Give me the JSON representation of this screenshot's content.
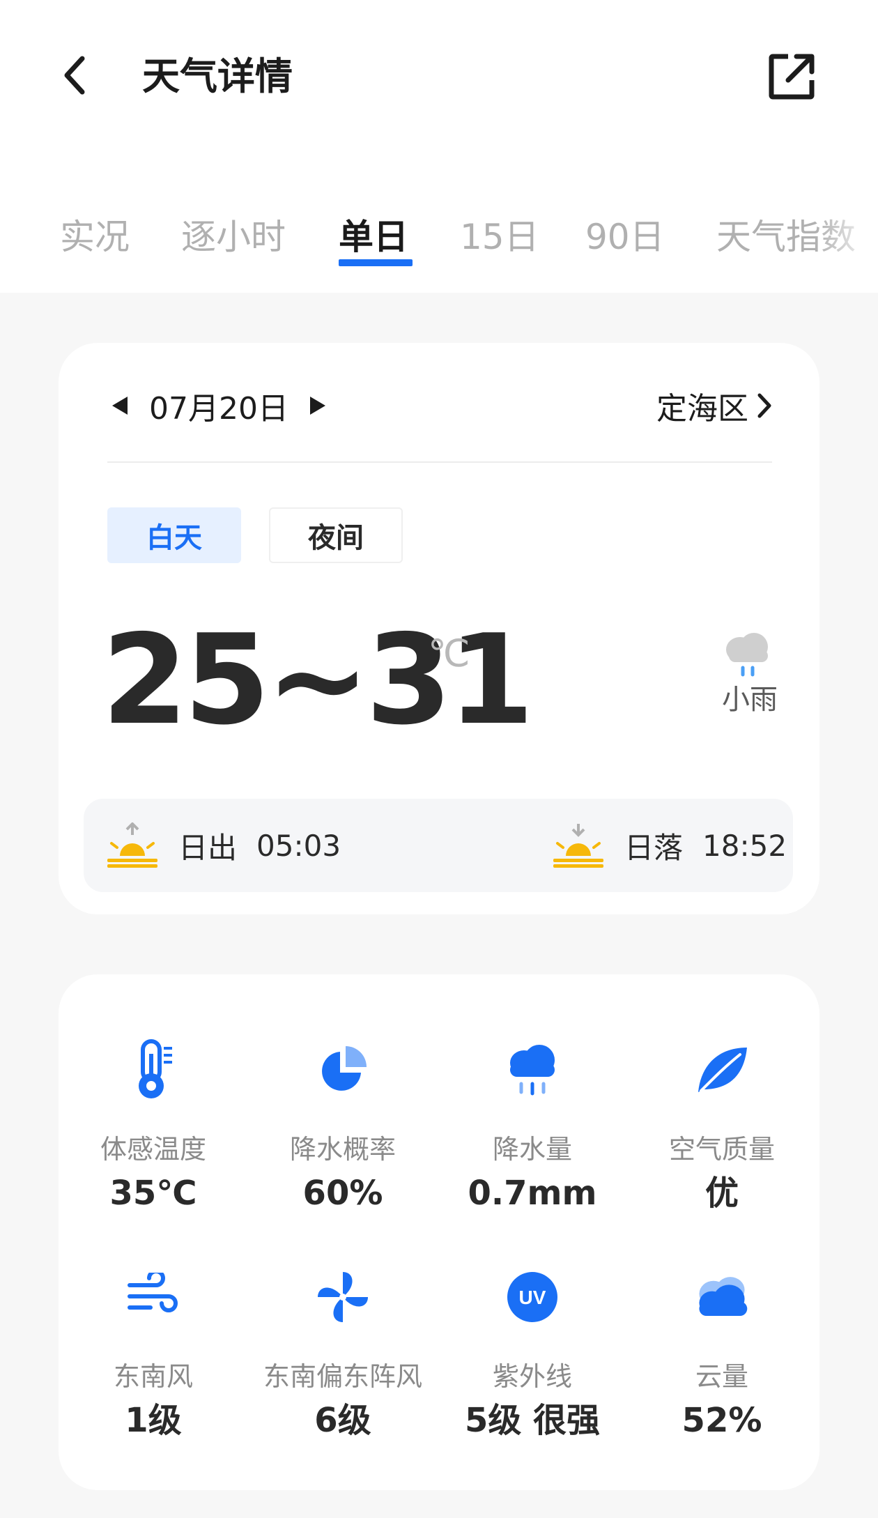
{
  "header": {
    "title": "天气详情",
    "back_icon": "back-arrow-icon",
    "share_icon": "open-external-icon"
  },
  "tabs": [
    {
      "label": "实况",
      "active": false
    },
    {
      "label": "逐小时",
      "active": false
    },
    {
      "label": "单日",
      "active": true
    },
    {
      "label": "15日",
      "active": false
    },
    {
      "label": "90日",
      "active": false
    },
    {
      "label": "天气指数",
      "active": false
    }
  ],
  "day_card": {
    "date": "07月20日",
    "location": "定海区",
    "segments": {
      "day": "白天",
      "night": "夜间",
      "selected": "day"
    },
    "temperature": "25~31",
    "unit": "℃",
    "condition": "小雨",
    "sunrise": {
      "label": "日出",
      "time": "05:03"
    },
    "sunset": {
      "label": "日落",
      "time": "18:52"
    }
  },
  "metrics": [
    {
      "icon": "thermometer-icon",
      "label": "体感温度",
      "value": "35℃"
    },
    {
      "icon": "pie-chart-icon",
      "label": "降水概率",
      "value": "60%"
    },
    {
      "icon": "rain-cloud-icon",
      "label": "降水量",
      "value": "0.7mm"
    },
    {
      "icon": "leaf-icon",
      "label": "空气质量",
      "value": "优"
    },
    {
      "icon": "wind-icon",
      "label": "东南风",
      "value": "1级"
    },
    {
      "icon": "pinwheel-icon",
      "label": "东南偏东阵风",
      "value": "6级"
    },
    {
      "icon": "uv-icon",
      "label": "紫外线",
      "value": "5级 很强"
    },
    {
      "icon": "cloud-icon",
      "label": "云量",
      "value": "52%"
    }
  ],
  "colors": {
    "accent": "#1a6ff5",
    "sun": "#f6b80a",
    "background": "#f7f7f7"
  }
}
